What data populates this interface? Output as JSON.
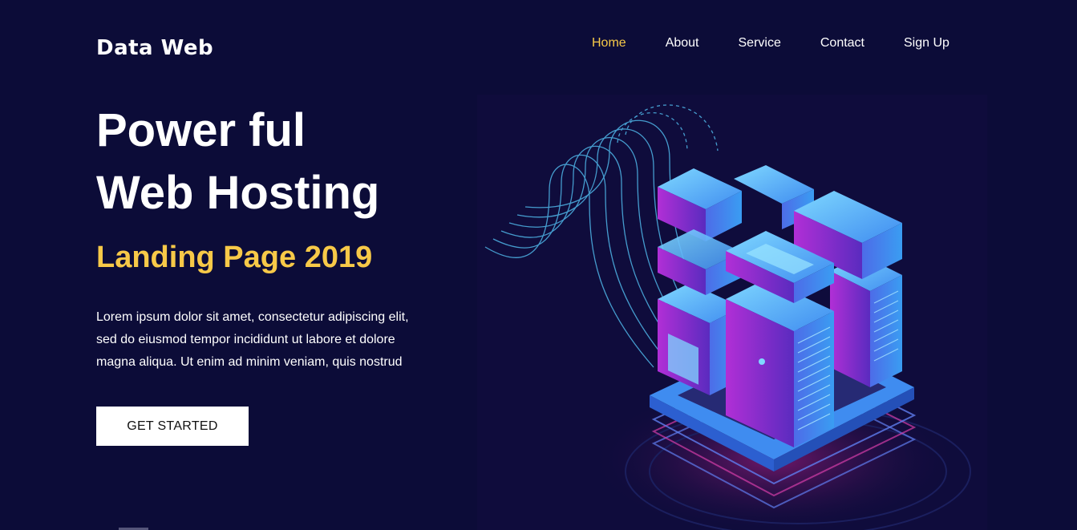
{
  "brand": {
    "name": "Data Web"
  },
  "nav": {
    "items": [
      {
        "label": "Home",
        "active": true
      },
      {
        "label": "About",
        "active": false
      },
      {
        "label": "Service",
        "active": false
      },
      {
        "label": "Contact",
        "active": false
      },
      {
        "label": "Sign Up",
        "active": false
      }
    ]
  },
  "hero": {
    "headline_line1": "Power ful",
    "headline_line2": "Web Hosting",
    "subheadline": "Landing Page 2019",
    "description_line1": "Lorem ipsum dolor sit amet, consectetur adipiscing elit,",
    "description_line2": "sed do eiusmod tempor incididunt ut labore et dolore",
    "description_line3": "magna aliqua. Ut enim ad minim veniam, quis nostrud",
    "cta_label": "GET STARTED",
    "illustration_icon": "server-rack-isometric-icon"
  },
  "colors": {
    "background": "#0c0c38",
    "accent": "#f7c948",
    "text": "#ffffff"
  }
}
